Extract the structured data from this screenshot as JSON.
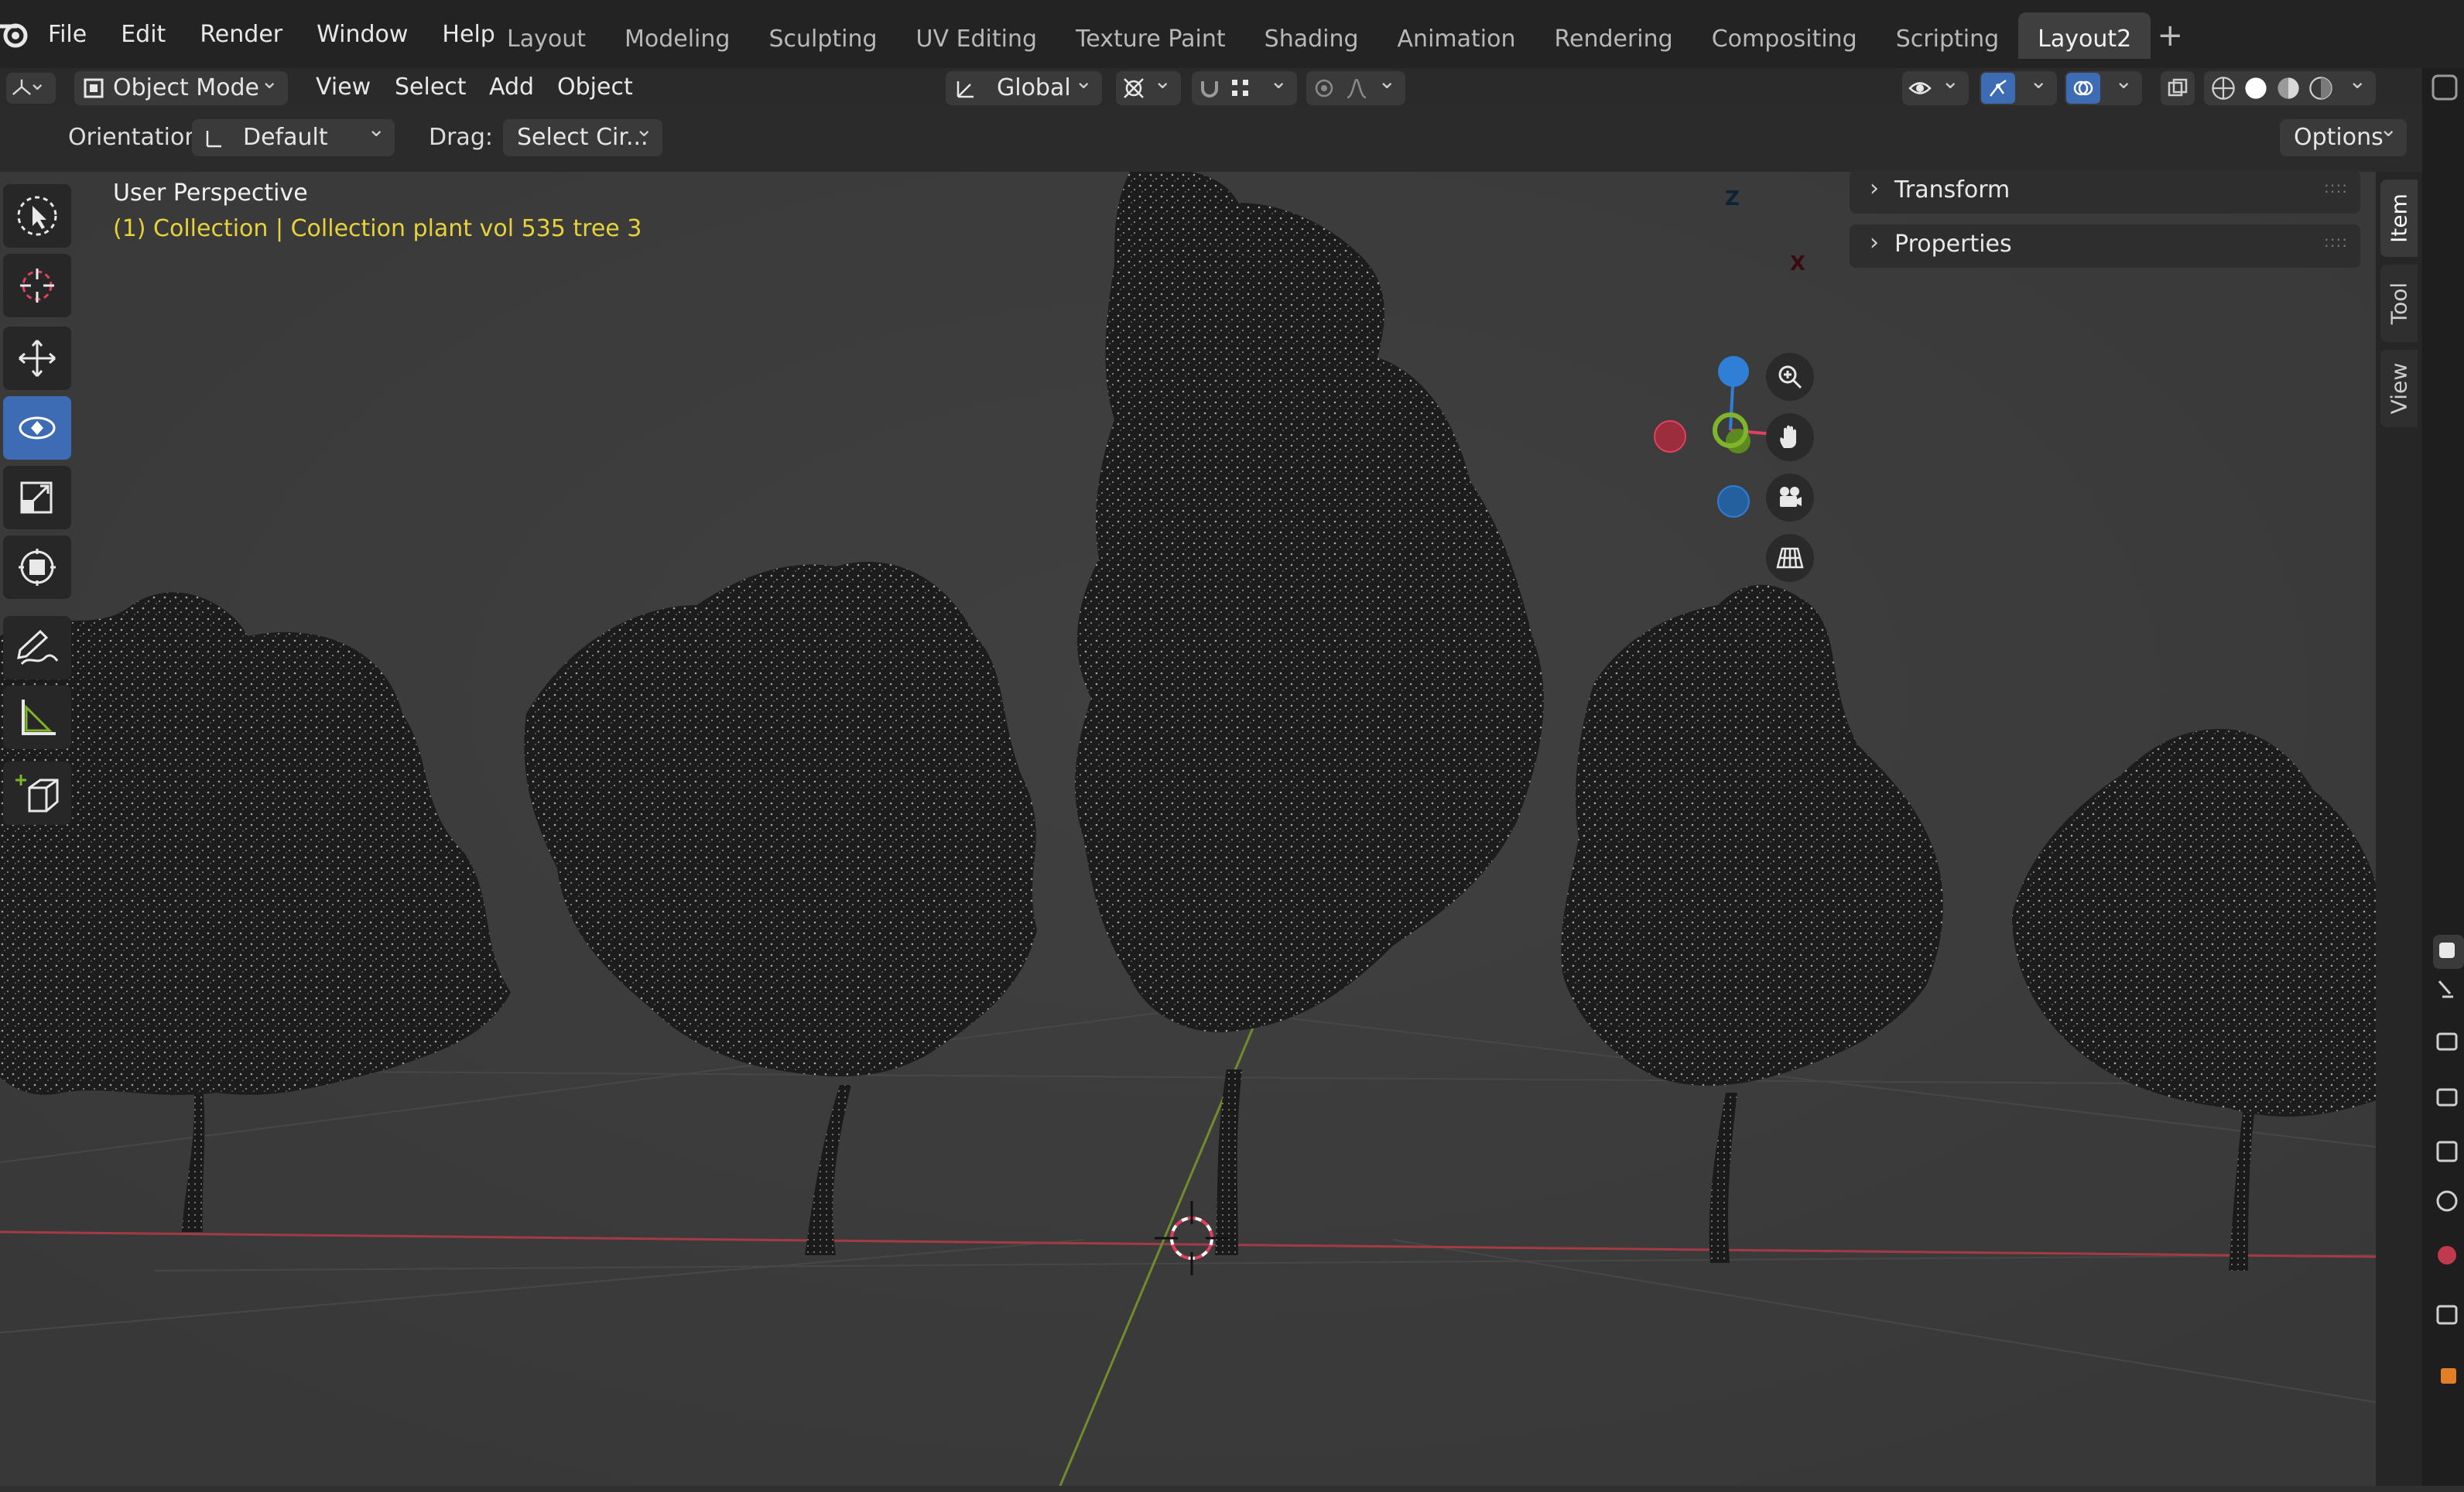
{
  "menu": {
    "file": "File",
    "edit": "Edit",
    "render": "Render",
    "window": "Window",
    "help": "Help"
  },
  "workspaces": [
    "Layout",
    "Modeling",
    "Sculpting",
    "UV Editing",
    "Texture Paint",
    "Shading",
    "Animation",
    "Rendering",
    "Compositing",
    "Scripting",
    "Layout2"
  ],
  "active_workspace": "Layout2",
  "header": {
    "mode": "Object Mode",
    "view": "View",
    "select": "Select",
    "add": "Add",
    "object": "Object",
    "transform_space": "Global"
  },
  "tool_header": {
    "orientation_label": "Orientation:",
    "orientation_value": "Default",
    "drag_label": "Drag:",
    "drag_value": "Select Cir...",
    "options": "Options"
  },
  "viewport": {
    "view_name": "User Perspective",
    "collection_info": "(1) Collection | Collection plant vol 535 tree 3"
  },
  "gizmo": {
    "z": "Z",
    "x": "X"
  },
  "npanel": {
    "sections": [
      "Transform",
      "Properties"
    ],
    "tabs": [
      "Item",
      "Tool",
      "View"
    ],
    "active_tab": "Item"
  },
  "colors": {
    "accent": "#3d6cb4",
    "info_text": "#e6d23a",
    "axis_x": "#e34060",
    "axis_y": "#7fb52a",
    "axis_z": "#2f7fd6"
  }
}
